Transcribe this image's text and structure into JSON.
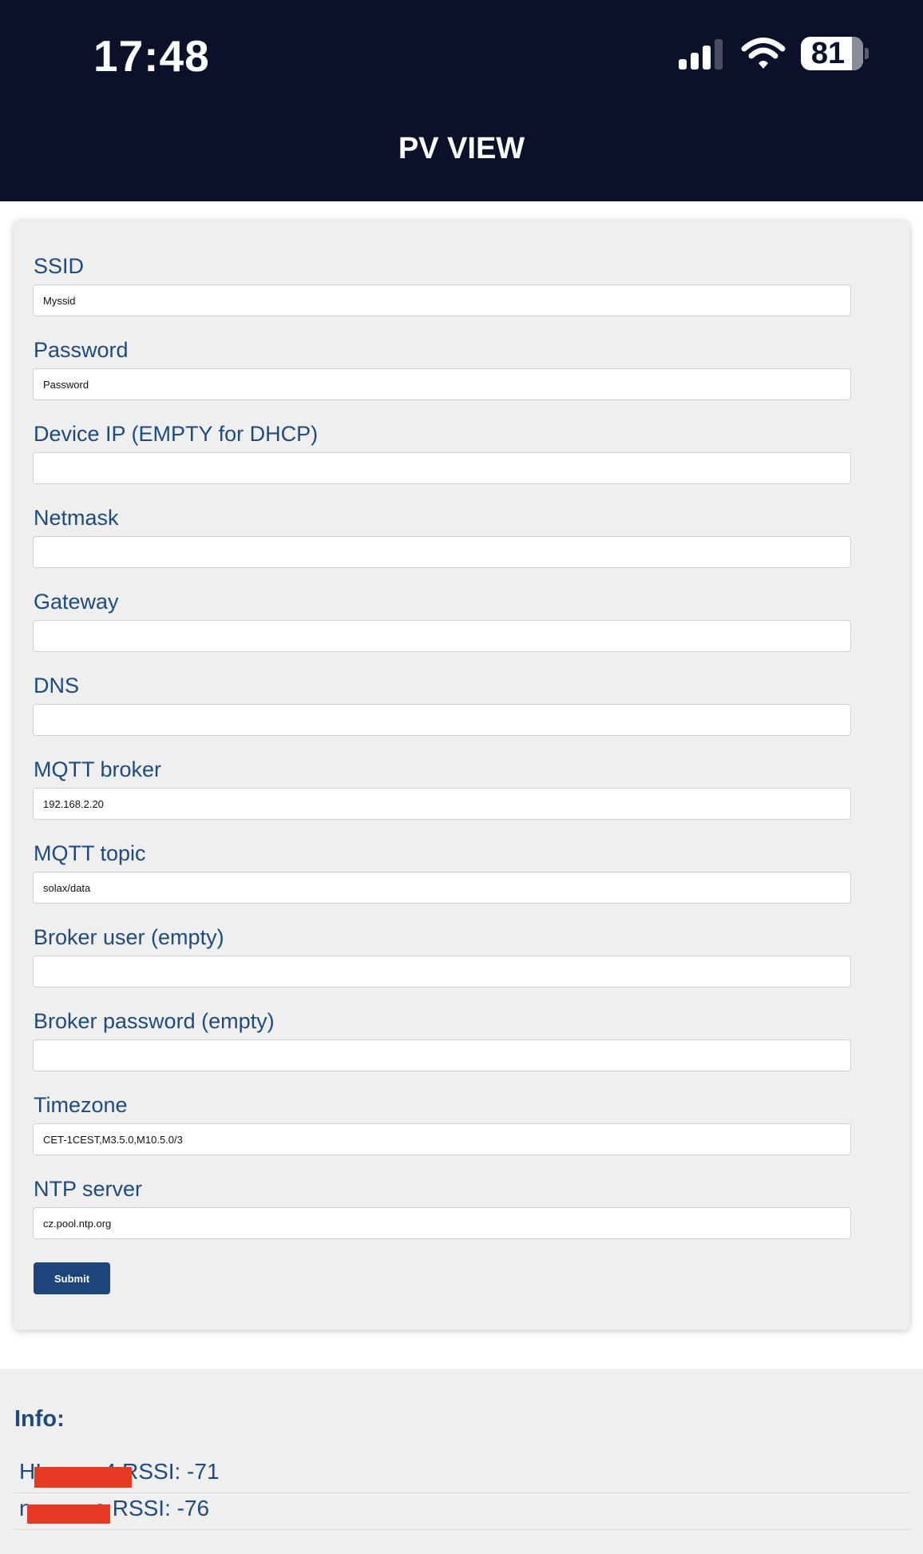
{
  "status_bar": {
    "time": "17:48",
    "battery": "81",
    "icons": [
      "cellular-signal-icon",
      "wifi-icon",
      "battery-icon"
    ]
  },
  "header": {
    "title": "PV VIEW"
  },
  "form": {
    "fields": [
      {
        "label": "SSID",
        "value": "Myssid"
      },
      {
        "label": "Password",
        "value": "Password"
      },
      {
        "label": "Device IP (EMPTY for DHCP)",
        "value": ""
      },
      {
        "label": "Netmask",
        "value": ""
      },
      {
        "label": "Gateway",
        "value": ""
      },
      {
        "label": "DNS",
        "value": ""
      },
      {
        "label": "MQTT broker",
        "value": "192.168.2.20"
      },
      {
        "label": "MQTT topic",
        "value": "solax/data"
      },
      {
        "label": "Broker user (empty)",
        "value": ""
      },
      {
        "label": "Broker password (empty)",
        "value": ""
      },
      {
        "label": "Timezone",
        "value": "CET-1CEST,M3.5.0,M10.5.0/3"
      },
      {
        "label": "NTP server",
        "value": "cz.pool.ntp.org"
      }
    ],
    "submit_label": "Submit"
  },
  "info": {
    "title": "Info:",
    "networks": [
      {
        "text": "HI          4 RSSI: -71"
      },
      {
        "text": "n          e RSSI: -76"
      }
    ]
  },
  "colors": {
    "header_bg": "#0b1128",
    "label_text": "#1e4a7e",
    "button_bg": "#1d4579",
    "card_bg": "#efefef",
    "redaction": "#e83a23"
  }
}
